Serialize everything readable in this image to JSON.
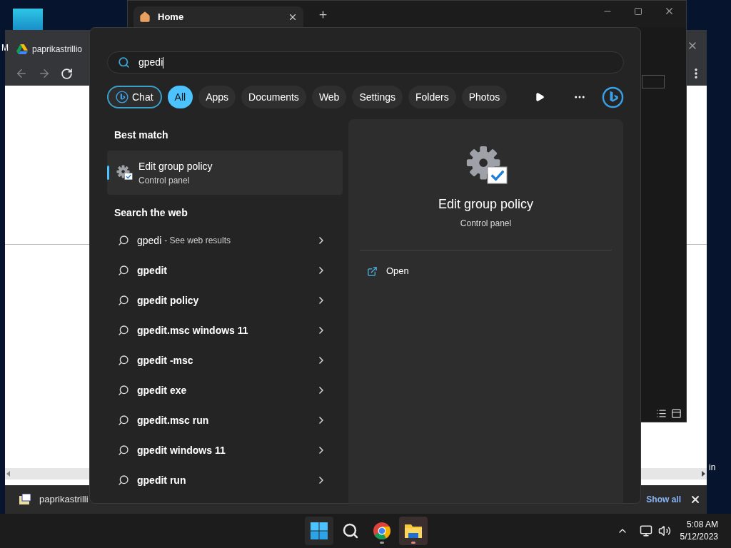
{
  "desktop": {
    "labels": [
      "M",
      "in"
    ]
  },
  "browser": {
    "tab": "paprikastrillio",
    "download": {
      "filename": "paprikastrilli",
      "show_all": "Show all"
    }
  },
  "explorer": {
    "tab": "Home"
  },
  "search": {
    "query": "gpedi",
    "filters": [
      {
        "label": "Chat",
        "kind": "chat",
        "selected": false
      },
      {
        "label": "All",
        "kind": "text",
        "selected": true
      },
      {
        "label": "Apps",
        "kind": "text",
        "selected": false
      },
      {
        "label": "Documents",
        "kind": "text",
        "selected": false
      },
      {
        "label": "Web",
        "kind": "text",
        "selected": false
      },
      {
        "label": "Settings",
        "kind": "text",
        "selected": false
      },
      {
        "label": "Folders",
        "kind": "text",
        "selected": false
      },
      {
        "label": "Photos",
        "kind": "text",
        "selected": false
      }
    ],
    "best_match": {
      "heading": "Best match",
      "title": "Edit group policy",
      "subtitle": "Control panel",
      "selected": true
    },
    "web": {
      "heading": "Search the web",
      "results": [
        {
          "text": "gpedi",
          "hint": "- See web results"
        },
        {
          "text": "gpedit"
        },
        {
          "text": "gpedit policy"
        },
        {
          "text": "gpedit.msc windows 11"
        },
        {
          "text": "gpedit -msc"
        },
        {
          "text": "gpedit exe"
        },
        {
          "text": "gpedit.msc run"
        },
        {
          "text": "gpedit windows 11"
        },
        {
          "text": "gpedit run"
        }
      ]
    },
    "preview": {
      "title": "Edit group policy",
      "subtitle": "Control panel",
      "actions": [
        "Open"
      ]
    }
  },
  "taskbar": {
    "apps": [
      {
        "kind": "start",
        "running": false,
        "active": false
      },
      {
        "kind": "search",
        "running": false,
        "active": false
      },
      {
        "kind": "chrome",
        "running": true,
        "active": false
      },
      {
        "kind": "explorer",
        "running": true,
        "active": true
      }
    ],
    "clock": {
      "time": "5:08 AM",
      "date": "5/12/2023"
    }
  }
}
